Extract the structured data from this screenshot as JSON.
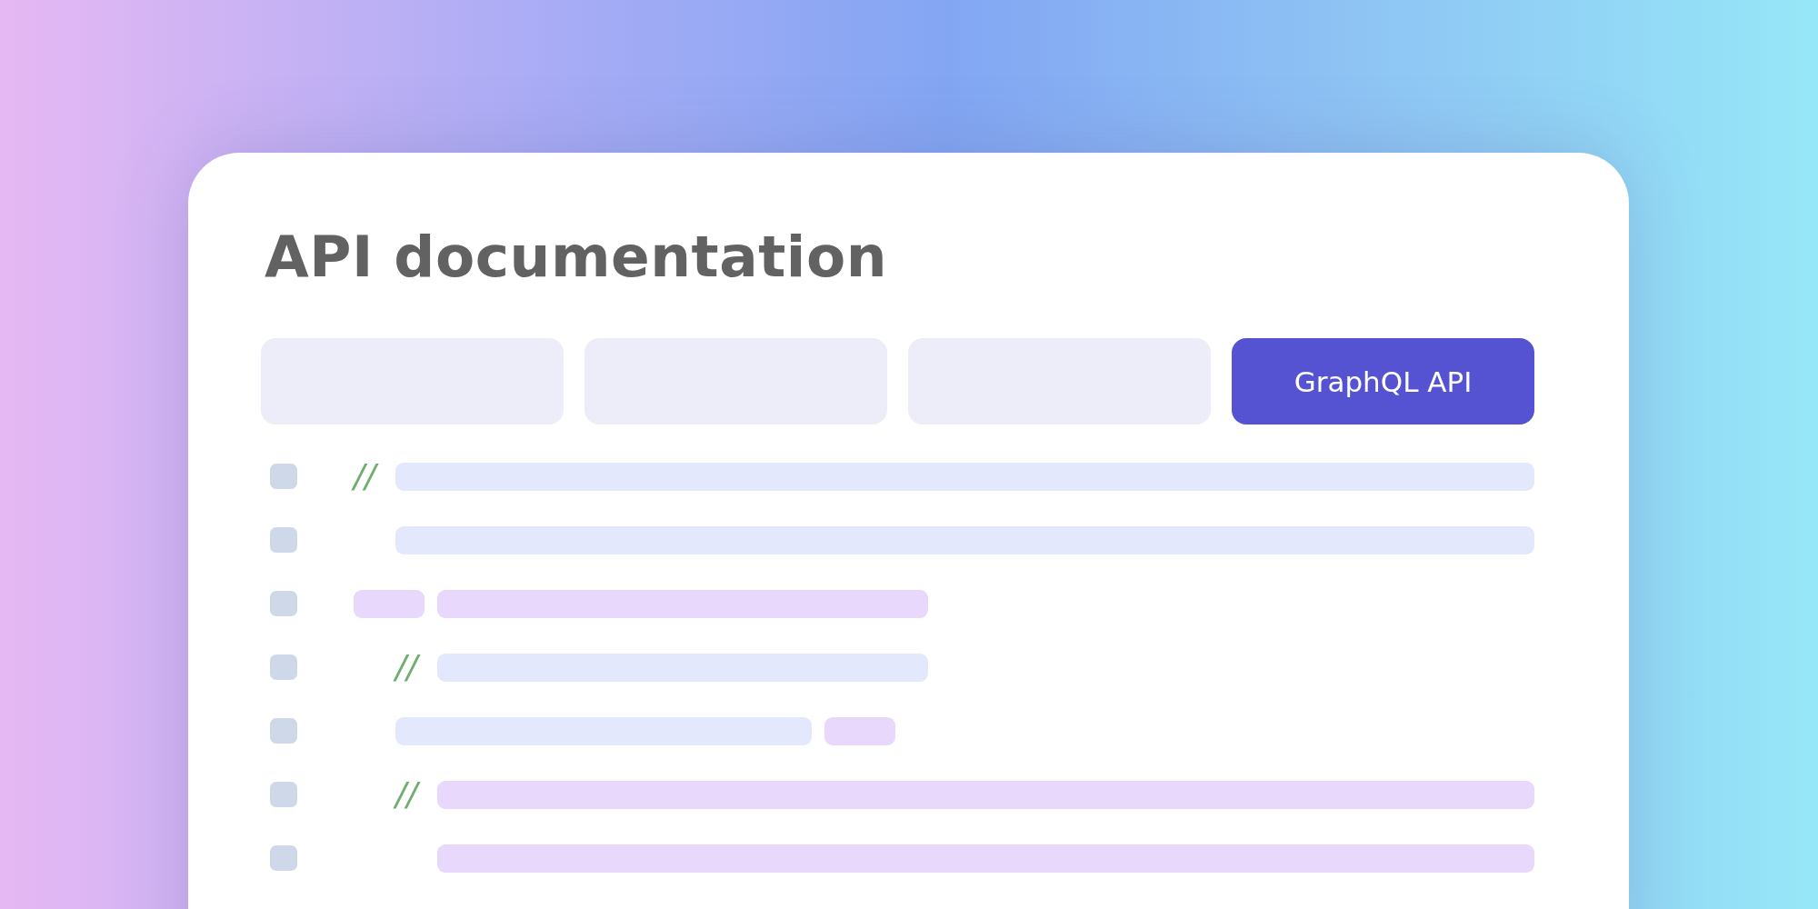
{
  "title": "API documentation",
  "tabs": [
    {
      "selected": false
    },
    {
      "selected": false
    },
    {
      "selected": false
    },
    {
      "label": "GraphQL API",
      "selected": true
    }
  ],
  "lines": [
    {
      "segments": [
        {
          "kind": "comment",
          "text": "//"
        },
        {
          "kind": "wide",
          "color": "#e3e8fc"
        }
      ],
      "children": [
        {
          "segments": [
            {
              "kind": "wide",
              "color": "#e3e8fc"
            }
          ]
        }
      ]
    },
    {
      "segments": [
        {
          "kind": "short",
          "color": "#e8d8fb"
        },
        {
          "kind": "long",
          "color": "#e8d8fb"
        }
      ],
      "children": [
        {
          "segments": [
            {
              "kind": "comment",
              "text": "//"
            },
            {
              "kind": "long",
              "color": "#e3e8fc"
            }
          ]
        },
        {
          "segments": [
            {
              "kind": "medium",
              "color": "#e3e8fc"
            },
            {
              "kind": "short",
              "color": "#e8d8fb"
            }
          ]
        },
        {
          "segments": [
            {
              "kind": "comment",
              "text": "//"
            },
            {
              "kind": "wide",
              "color": "#e8d8fb"
            }
          ],
          "children": [
            {
              "segments": [
                {
                  "kind": "wide",
                  "color": "#e8d8fb"
                }
              ]
            }
          ]
        }
      ]
    }
  ]
}
